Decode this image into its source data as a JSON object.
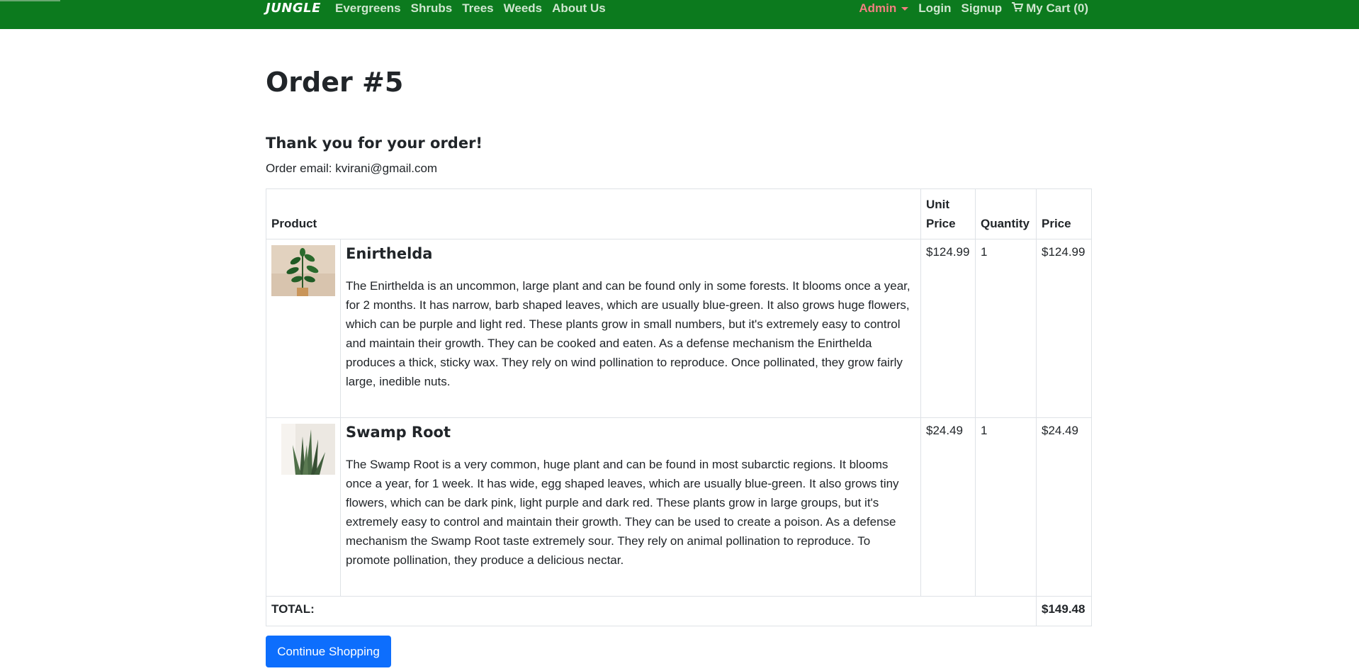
{
  "navbar": {
    "brand": "JUNGLE",
    "links": [
      "Evergreens",
      "Shrubs",
      "Trees",
      "Weeds",
      "About Us"
    ],
    "admin_label": "Admin",
    "login_label": "Login",
    "signup_label": "Signup",
    "cart_label": "My Cart (0)"
  },
  "order": {
    "title": "Order #5",
    "thanks": "Thank you for your order!",
    "email_label": "Order email: kvirani@gmail.com"
  },
  "table": {
    "headers": {
      "product": "Product",
      "unit_price_line1": "Unit",
      "unit_price_line2": "Price",
      "quantity": "Quantity",
      "price": "Price"
    },
    "items": [
      {
        "name": "Enirthelda",
        "description": "The Enirthelda is an uncommon, large plant and can be found only in some forests. It blooms once a year, for 2 months. It has narrow, barb shaped leaves, which are usually blue-green. It also grows huge flowers, which can be purple and light red. These plants grow in small numbers, but it's extremely easy to control and maintain their growth. They can be cooked and eaten. As a defense mechanism the Enirthelda produces a thick, sticky wax. They rely on wind pollination to reproduce. Once pollinated, they grow fairly large, inedible nuts.",
        "unit_price": "$124.99",
        "quantity": "1",
        "price": "$124.99"
      },
      {
        "name": "Swamp Root",
        "description": "The Swamp Root is a very common, huge plant and can be found in most subarctic regions. It blooms once a year, for 1 week. It has wide, egg shaped leaves, which are usually blue-green. It also grows tiny flowers, which can be dark pink, light purple and dark red. These plants grow in large groups, but it's extremely easy to control and maintain their growth. They can be used to create a poison. As a defense mechanism the Swamp Root taste extremely sour. They rely on animal pollination to reproduce. To promote pollination, they produce a delicious nectar.",
        "unit_price": "$24.49",
        "quantity": "1",
        "price": "$24.49"
      }
    ],
    "total_label": "TOTAL:",
    "total_value": "$149.48"
  },
  "continue_button": "Continue Shopping",
  "colors": {
    "navbar": "#0c7a1e",
    "nav_link": "#cfe6cf",
    "admin": "#f08080",
    "button": "#0d6efd"
  }
}
